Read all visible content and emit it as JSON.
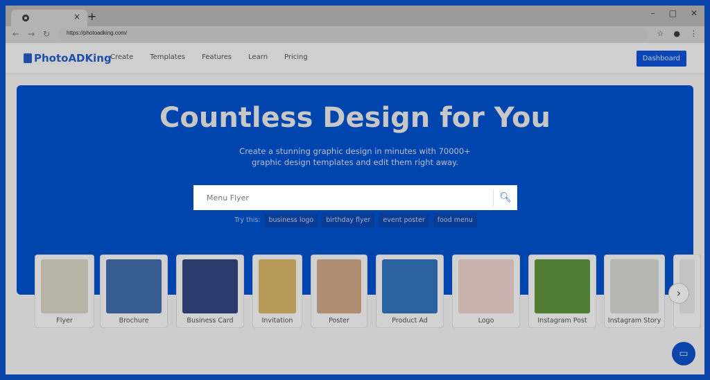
{
  "browser": {
    "url": "https://photoadking.com/",
    "tab_close": "×",
    "new_tab": "+",
    "controls": [
      "–",
      "□",
      "✕"
    ]
  },
  "header": {
    "logo": "PhotoADKing",
    "menu": [
      "Create",
      "Templates",
      "Features",
      "Learn",
      "Pricing"
    ],
    "dashboard": "Dashboard"
  },
  "hero": {
    "title": "Countless Design for You",
    "subtitle_1": "Create a stunning graphic design in minutes with 70000+",
    "subtitle_2": "graphic design templates and edit them right away.",
    "search_value": "Menu Flyer",
    "try_label": "Try this:",
    "suggestions": [
      "business logo",
      "birthday flyer",
      "event poster",
      "food menu"
    ]
  },
  "categories": [
    {
      "label": "Flyer",
      "color": "#b9b3a6"
    },
    {
      "label": "Brochure",
      "color": "#375c8f"
    },
    {
      "label": "Business Card",
      "color": "#2b3c6c"
    },
    {
      "label": "Invitation",
      "color": "#b89a58"
    },
    {
      "label": "Poster",
      "color": "#b08e74"
    },
    {
      "label": "Product Ad",
      "color": "#2b63a0"
    },
    {
      "label": "Logo",
      "color": "#c9b1ad"
    },
    {
      "label": "Instagram Post",
      "color": "#4f7d32"
    },
    {
      "label": "Instagram Story",
      "color": "#b6b6b2"
    }
  ],
  "colors": {
    "brand": "#0044ad",
    "accent": "#0c46b4"
  }
}
